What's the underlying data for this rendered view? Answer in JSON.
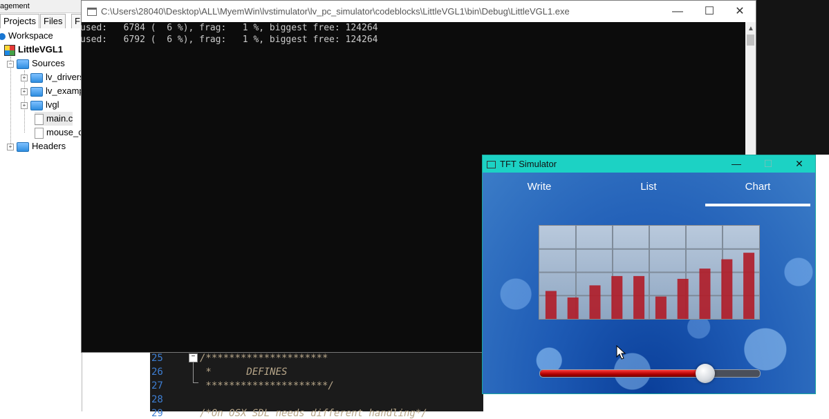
{
  "management": {
    "title": "agement",
    "tabs": [
      "Projects",
      "Files",
      "F"
    ],
    "tree": {
      "workspace": "Workspace",
      "project": "LittleVGL1",
      "sources": "Sources",
      "lv_drivers": "lv_drivers",
      "lv_examples": "lv_examp",
      "lvgl": "lvgl",
      "main_c": "main.c",
      "mouse_c": "mouse_c",
      "headers": "Headers"
    }
  },
  "editor": {
    "line_numbers": [
      "25",
      "26",
      "27",
      "28",
      "29"
    ],
    "lines": [
      "/*********************",
      " *      DEFINES",
      " *********************/",
      "",
      "/*On OSX SDL needs different handling*/"
    ]
  },
  "console": {
    "title": "C:\\Users\\28040\\Desktop\\ALL\\MyemWin\\lvstimulator\\lv_pc_simulator\\codeblocks\\LittleVGL1\\bin\\Debug\\LittleVGL1.exe",
    "lines": [
      "used:   6784 (  6 %), frag:   1 %, biggest free: 124264",
      "used:   6792 (  6 %), frag:   1 %, biggest free: 124264"
    ],
    "buttons": {
      "minimize": "—",
      "maximize": "☐",
      "close": "✕"
    }
  },
  "tft": {
    "title": "TFT Simulator",
    "buttons": {
      "minimize": "—",
      "maximize": "☐",
      "close": "✕"
    },
    "tabs": [
      "Write",
      "List",
      "Chart"
    ],
    "active_tab": "Chart",
    "slider_value": 0.75
  },
  "chart_data": {
    "type": "bar",
    "title": "",
    "categories": [
      "",
      "",
      "",
      "",
      "",
      "",
      "",
      "",
      "",
      ""
    ],
    "values": [
      30,
      23,
      36,
      46,
      46,
      24,
      43,
      54,
      64,
      71
    ],
    "ylim": [
      0,
      100
    ],
    "grid": true,
    "grid_rows": 4,
    "grid_cols": 6,
    "colors": {
      "bar": "#b01e2a",
      "grid": "#7f8b99"
    }
  }
}
